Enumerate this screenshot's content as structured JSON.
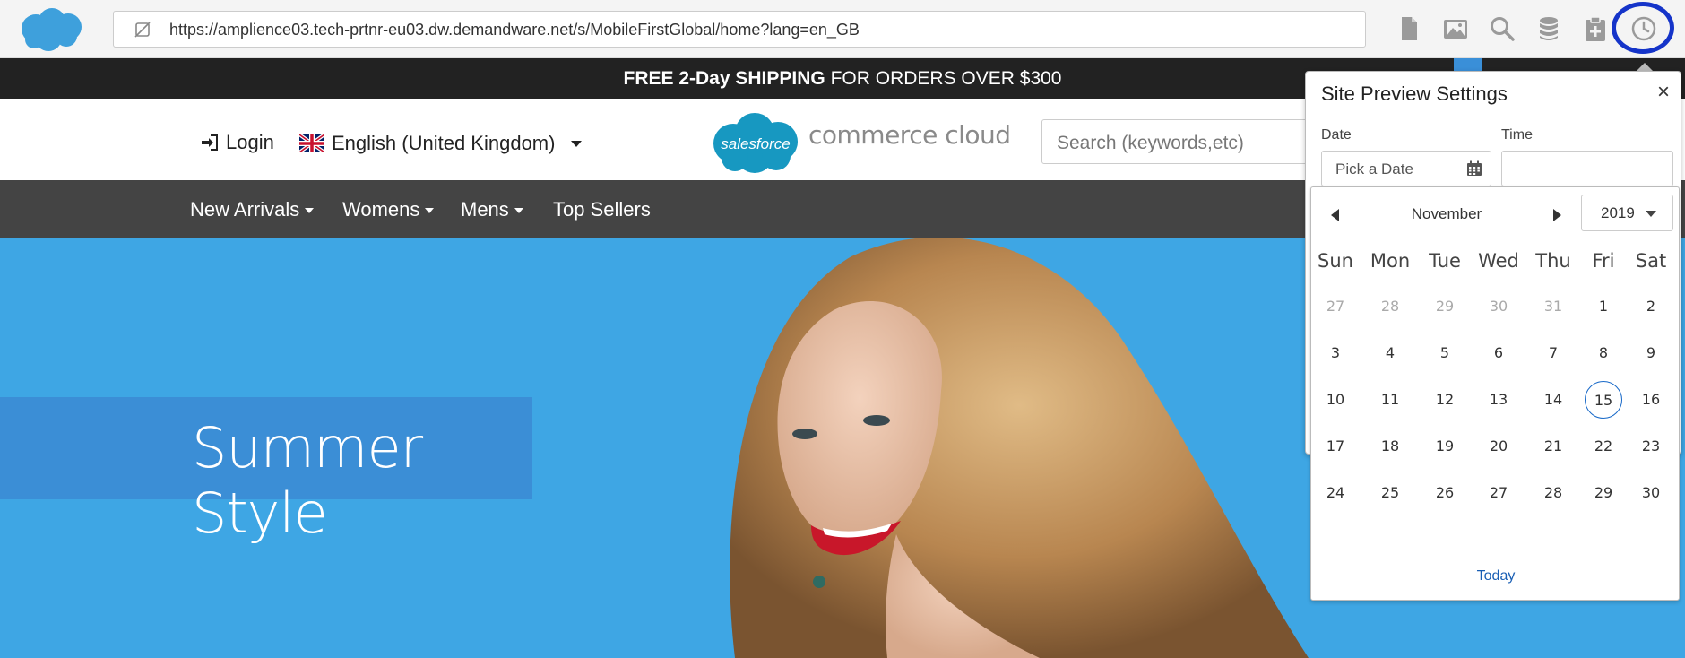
{
  "toolbar": {
    "url": "https://amplience03.tech-prtnr-eu03.dw.demandware.net/s/MobileFirstGlobal/home?lang=en_GB",
    "icons": [
      "page-icon",
      "image-icon",
      "search-icon",
      "database-icon",
      "clipboard-add-icon",
      "clock-icon"
    ]
  },
  "promo": {
    "bold": "FREE 2-Day SHIPPING",
    "rest": " FOR ORDERS OVER $300"
  },
  "header": {
    "login": "Login",
    "language": "English (United Kingdom)",
    "brand_logo_text": "salesforce",
    "brand_text": "commerce cloud",
    "search_placeholder": "Search (keywords,etc)"
  },
  "nav": {
    "items": [
      {
        "label": "New Arrivals",
        "has_menu": true
      },
      {
        "label": "Womens",
        "has_menu": true
      },
      {
        "label": "Mens",
        "has_menu": true
      },
      {
        "label": "Top Sellers",
        "has_menu": false
      }
    ]
  },
  "hero": {
    "title": "Summer Style"
  },
  "preview": {
    "title": "Site Preview Settings",
    "close": "×",
    "date_label": "Date",
    "time_label": "Time",
    "date_placeholder": "Pick a Date",
    "time_value": ""
  },
  "calendar": {
    "month": "November",
    "year": "2019",
    "weekdays": [
      "Sun",
      "Mon",
      "Tue",
      "Wed",
      "Thu",
      "Fri",
      "Sat"
    ],
    "weeks": [
      [
        "27",
        "28",
        "29",
        "30",
        "31",
        "1",
        "2"
      ],
      [
        "3",
        "4",
        "5",
        "6",
        "7",
        "8",
        "9"
      ],
      [
        "10",
        "11",
        "12",
        "13",
        "14",
        "15",
        "16"
      ],
      [
        "17",
        "18",
        "19",
        "20",
        "21",
        "22",
        "23"
      ],
      [
        "24",
        "25",
        "26",
        "27",
        "28",
        "29",
        "30"
      ]
    ],
    "muted_first_row_count": 5,
    "selected_day": "15",
    "today_label": "Today"
  },
  "colors": {
    "promo_bg": "#222222",
    "nav_bg": "#444444",
    "hero_bg": "#3ea6e4",
    "hero_label_bg": "#3b8ed6",
    "highlight_ring": "#1534c9",
    "link": "#1a5fb4"
  }
}
